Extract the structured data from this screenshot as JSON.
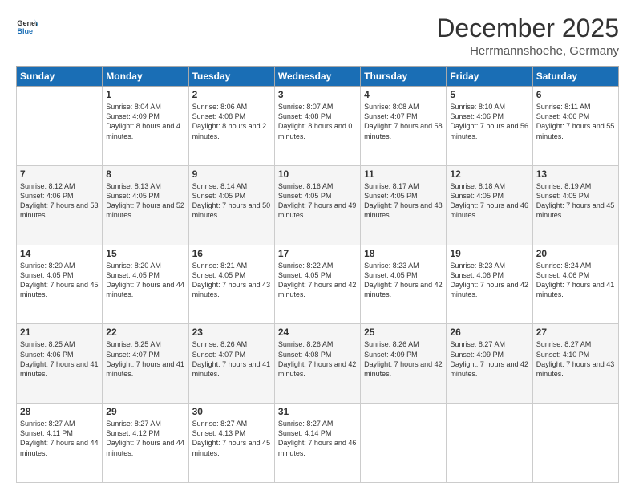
{
  "logo": {
    "line1": "General",
    "line2": "Blue"
  },
  "title": "December 2025",
  "location": "Herrmannshoehe, Germany",
  "weekdays": [
    "Sunday",
    "Monday",
    "Tuesday",
    "Wednesday",
    "Thursday",
    "Friday",
    "Saturday"
  ],
  "weeks": [
    [
      {
        "day": "",
        "sunrise": "",
        "sunset": "",
        "daylight": ""
      },
      {
        "day": "1",
        "sunrise": "Sunrise: 8:04 AM",
        "sunset": "Sunset: 4:09 PM",
        "daylight": "Daylight: 8 hours and 4 minutes."
      },
      {
        "day": "2",
        "sunrise": "Sunrise: 8:06 AM",
        "sunset": "Sunset: 4:08 PM",
        "daylight": "Daylight: 8 hours and 2 minutes."
      },
      {
        "day": "3",
        "sunrise": "Sunrise: 8:07 AM",
        "sunset": "Sunset: 4:08 PM",
        "daylight": "Daylight: 8 hours and 0 minutes."
      },
      {
        "day": "4",
        "sunrise": "Sunrise: 8:08 AM",
        "sunset": "Sunset: 4:07 PM",
        "daylight": "Daylight: 7 hours and 58 minutes."
      },
      {
        "day": "5",
        "sunrise": "Sunrise: 8:10 AM",
        "sunset": "Sunset: 4:06 PM",
        "daylight": "Daylight: 7 hours and 56 minutes."
      },
      {
        "day": "6",
        "sunrise": "Sunrise: 8:11 AM",
        "sunset": "Sunset: 4:06 PM",
        "daylight": "Daylight: 7 hours and 55 minutes."
      }
    ],
    [
      {
        "day": "7",
        "sunrise": "Sunrise: 8:12 AM",
        "sunset": "Sunset: 4:06 PM",
        "daylight": "Daylight: 7 hours and 53 minutes."
      },
      {
        "day": "8",
        "sunrise": "Sunrise: 8:13 AM",
        "sunset": "Sunset: 4:05 PM",
        "daylight": "Daylight: 7 hours and 52 minutes."
      },
      {
        "day": "9",
        "sunrise": "Sunrise: 8:14 AM",
        "sunset": "Sunset: 4:05 PM",
        "daylight": "Daylight: 7 hours and 50 minutes."
      },
      {
        "day": "10",
        "sunrise": "Sunrise: 8:16 AM",
        "sunset": "Sunset: 4:05 PM",
        "daylight": "Daylight: 7 hours and 49 minutes."
      },
      {
        "day": "11",
        "sunrise": "Sunrise: 8:17 AM",
        "sunset": "Sunset: 4:05 PM",
        "daylight": "Daylight: 7 hours and 48 minutes."
      },
      {
        "day": "12",
        "sunrise": "Sunrise: 8:18 AM",
        "sunset": "Sunset: 4:05 PM",
        "daylight": "Daylight: 7 hours and 46 minutes."
      },
      {
        "day": "13",
        "sunrise": "Sunrise: 8:19 AM",
        "sunset": "Sunset: 4:05 PM",
        "daylight": "Daylight: 7 hours and 45 minutes."
      }
    ],
    [
      {
        "day": "14",
        "sunrise": "Sunrise: 8:20 AM",
        "sunset": "Sunset: 4:05 PM",
        "daylight": "Daylight: 7 hours and 45 minutes."
      },
      {
        "day": "15",
        "sunrise": "Sunrise: 8:20 AM",
        "sunset": "Sunset: 4:05 PM",
        "daylight": "Daylight: 7 hours and 44 minutes."
      },
      {
        "day": "16",
        "sunrise": "Sunrise: 8:21 AM",
        "sunset": "Sunset: 4:05 PM",
        "daylight": "Daylight: 7 hours and 43 minutes."
      },
      {
        "day": "17",
        "sunrise": "Sunrise: 8:22 AM",
        "sunset": "Sunset: 4:05 PM",
        "daylight": "Daylight: 7 hours and 42 minutes."
      },
      {
        "day": "18",
        "sunrise": "Sunrise: 8:23 AM",
        "sunset": "Sunset: 4:05 PM",
        "daylight": "Daylight: 7 hours and 42 minutes."
      },
      {
        "day": "19",
        "sunrise": "Sunrise: 8:23 AM",
        "sunset": "Sunset: 4:06 PM",
        "daylight": "Daylight: 7 hours and 42 minutes."
      },
      {
        "day": "20",
        "sunrise": "Sunrise: 8:24 AM",
        "sunset": "Sunset: 4:06 PM",
        "daylight": "Daylight: 7 hours and 41 minutes."
      }
    ],
    [
      {
        "day": "21",
        "sunrise": "Sunrise: 8:25 AM",
        "sunset": "Sunset: 4:06 PM",
        "daylight": "Daylight: 7 hours and 41 minutes."
      },
      {
        "day": "22",
        "sunrise": "Sunrise: 8:25 AM",
        "sunset": "Sunset: 4:07 PM",
        "daylight": "Daylight: 7 hours and 41 minutes."
      },
      {
        "day": "23",
        "sunrise": "Sunrise: 8:26 AM",
        "sunset": "Sunset: 4:07 PM",
        "daylight": "Daylight: 7 hours and 41 minutes."
      },
      {
        "day": "24",
        "sunrise": "Sunrise: 8:26 AM",
        "sunset": "Sunset: 4:08 PM",
        "daylight": "Daylight: 7 hours and 42 minutes."
      },
      {
        "day": "25",
        "sunrise": "Sunrise: 8:26 AM",
        "sunset": "Sunset: 4:09 PM",
        "daylight": "Daylight: 7 hours and 42 minutes."
      },
      {
        "day": "26",
        "sunrise": "Sunrise: 8:27 AM",
        "sunset": "Sunset: 4:09 PM",
        "daylight": "Daylight: 7 hours and 42 minutes."
      },
      {
        "day": "27",
        "sunrise": "Sunrise: 8:27 AM",
        "sunset": "Sunset: 4:10 PM",
        "daylight": "Daylight: 7 hours and 43 minutes."
      }
    ],
    [
      {
        "day": "28",
        "sunrise": "Sunrise: 8:27 AM",
        "sunset": "Sunset: 4:11 PM",
        "daylight": "Daylight: 7 hours and 44 minutes."
      },
      {
        "day": "29",
        "sunrise": "Sunrise: 8:27 AM",
        "sunset": "Sunset: 4:12 PM",
        "daylight": "Daylight: 7 hours and 44 minutes."
      },
      {
        "day": "30",
        "sunrise": "Sunrise: 8:27 AM",
        "sunset": "Sunset: 4:13 PM",
        "daylight": "Daylight: 7 hours and 45 minutes."
      },
      {
        "day": "31",
        "sunrise": "Sunrise: 8:27 AM",
        "sunset": "Sunset: 4:14 PM",
        "daylight": "Daylight: 7 hours and 46 minutes."
      },
      {
        "day": "",
        "sunrise": "",
        "sunset": "",
        "daylight": ""
      },
      {
        "day": "",
        "sunrise": "",
        "sunset": "",
        "daylight": ""
      },
      {
        "day": "",
        "sunrise": "",
        "sunset": "",
        "daylight": ""
      }
    ]
  ]
}
